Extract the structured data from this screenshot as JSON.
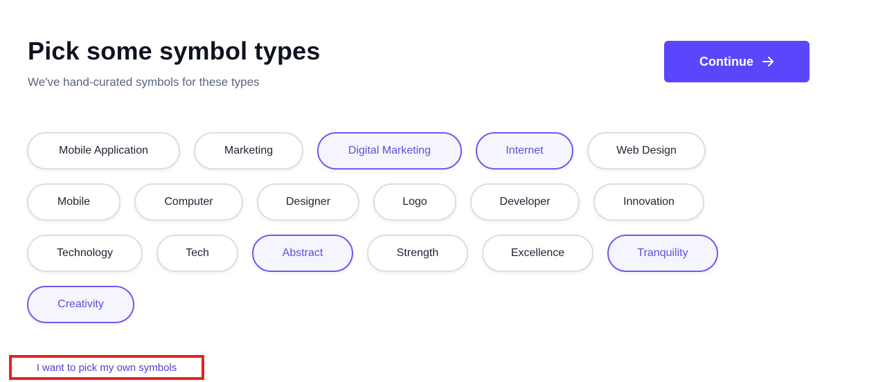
{
  "header": {
    "title": "Pick some symbol types",
    "subtitle": "We've hand-curated symbols for these types"
  },
  "actions": {
    "continue_label": "Continue",
    "continue_icon": "arrow-right-icon",
    "own_symbols_link": "I want to pick my own symbols"
  },
  "colors": {
    "accent": "#5b47fb",
    "selected_border": "#6b5af0",
    "selected_text": "#5b4fd8",
    "highlight_box": "#e02424"
  },
  "chips": [
    {
      "label": "Mobile Application",
      "selected": false
    },
    {
      "label": "Marketing",
      "selected": false
    },
    {
      "label": "Digital Marketing",
      "selected": true
    },
    {
      "label": "Internet",
      "selected": true
    },
    {
      "label": "Web Design",
      "selected": false
    },
    {
      "label": "Mobile",
      "selected": false
    },
    {
      "label": "Computer",
      "selected": false
    },
    {
      "label": "Designer",
      "selected": false
    },
    {
      "label": "Logo",
      "selected": false
    },
    {
      "label": "Developer",
      "selected": false
    },
    {
      "label": "Innovation",
      "selected": false
    },
    {
      "label": "Technology",
      "selected": false
    },
    {
      "label": "Tech",
      "selected": false
    },
    {
      "label": "Abstract",
      "selected": true
    },
    {
      "label": "Strength",
      "selected": false
    },
    {
      "label": "Excellence",
      "selected": false
    },
    {
      "label": "Tranquility",
      "selected": true
    },
    {
      "label": "Creativity",
      "selected": true
    }
  ]
}
